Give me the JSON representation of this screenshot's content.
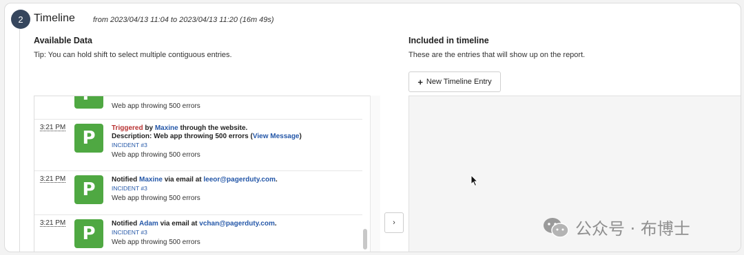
{
  "section": {
    "step_number": "2",
    "title": "Timeline",
    "range": "from 2023/04/13 11:04 to 2023/04/13 11:20 (16m 49s)"
  },
  "available": {
    "title": "Available Data",
    "tip": "Tip: You can hold shift to select multiple contiguous entries."
  },
  "included": {
    "title": "Included in timeline",
    "subtitle": "These are the entries that will show up on the report.",
    "new_entry_label": "New Timeline Entry"
  },
  "entries": [
    {
      "summary": "Web app throwing 500 errors"
    },
    {
      "time": "3:21 PM",
      "status": "Triggered",
      "by": "by",
      "user": "Maxine",
      "rest": "through the website.",
      "desc_prefix": "Description: Web app throwing 500 errors (",
      "link": "View Message",
      "desc_suffix": ")",
      "incident": "INCIDENT #3",
      "summary": "Web app throwing 500 errors"
    },
    {
      "time": "3:21 PM",
      "action": "Notified",
      "user": "Maxine",
      "via": "via email at",
      "email": "leeor@pagerduty.com",
      "dot": ".",
      "incident": "INCIDENT #3",
      "summary": "Web app throwing 500 errors"
    },
    {
      "time": "3:21 PM",
      "action": "Notified",
      "user": "Adam",
      "via": "via email at",
      "email": "vchan@pagerduty.com",
      "dot": ".",
      "incident": "INCIDENT #3",
      "summary": "Web app throwing 500 errors"
    }
  ],
  "logo_letter": "P",
  "move_button": "›",
  "watermark": {
    "text": "公众号 · 布博士"
  }
}
